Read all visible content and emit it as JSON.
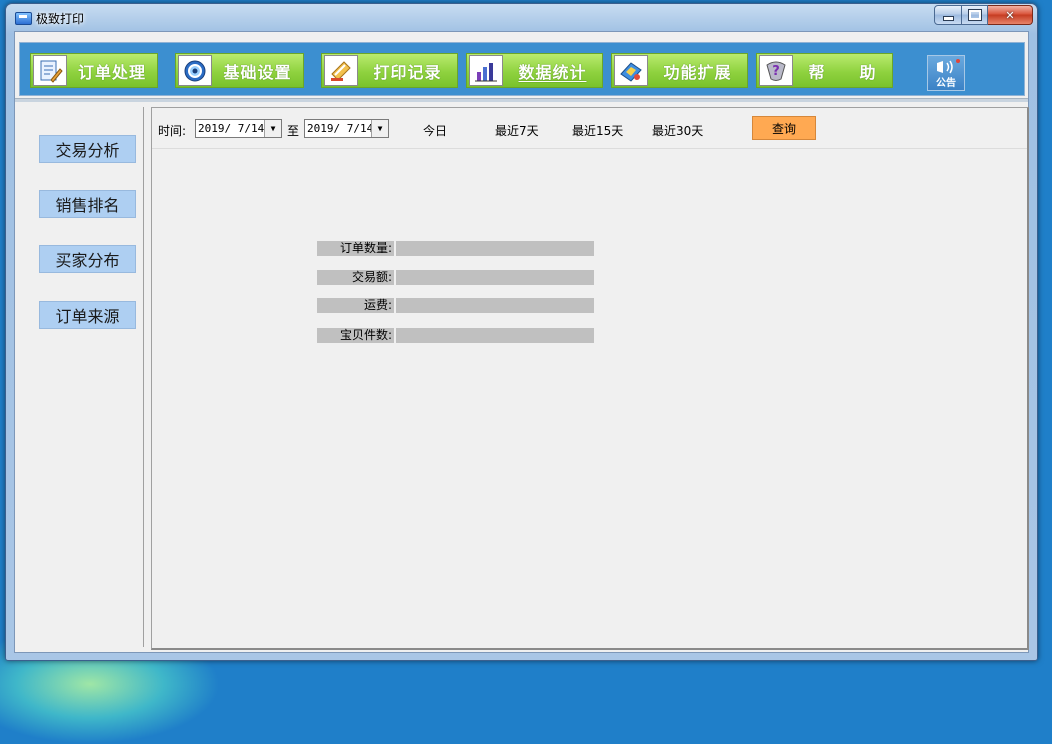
{
  "window": {
    "title": "极致打印"
  },
  "toolbar": {
    "items": [
      {
        "label": "订单处理",
        "icon": "order-document-icon"
      },
      {
        "label": "基础设置",
        "icon": "settings-gear-icon"
      },
      {
        "label": "打印记录",
        "icon": "print-record-icon"
      },
      {
        "label": "数据统计",
        "icon": "bar-chart-icon",
        "active": true
      },
      {
        "label": "功能扩展",
        "icon": "extension-icon"
      },
      {
        "label": "帮　　助",
        "icon": "help-question-icon"
      }
    ],
    "notice_label": "公告"
  },
  "sidebar": {
    "items": [
      {
        "label": "交易分析"
      },
      {
        "label": "销售排名"
      },
      {
        "label": "买家分布"
      },
      {
        "label": "订单来源"
      }
    ]
  },
  "filter": {
    "time_label": "时间:",
    "start_date": "2019/ 7/14",
    "to_label": "至",
    "end_date": "2019/ 7/14",
    "quick_ranges": [
      "今日",
      "最近7天",
      "最近15天",
      "最近30天"
    ],
    "query_label": "查询"
  },
  "stats": [
    {
      "label": "订单数量:",
      "value": ""
    },
    {
      "label": "交易额:",
      "value": ""
    },
    {
      "label": "运费:",
      "value": ""
    },
    {
      "label": "宝贝件数:",
      "value": ""
    }
  ],
  "colors": {
    "toolbar_green": "#8fd23f",
    "sidebar_button": "#aecff2",
    "query_button": "#ffa952",
    "toolbar_frame": "#3c8fd0"
  }
}
